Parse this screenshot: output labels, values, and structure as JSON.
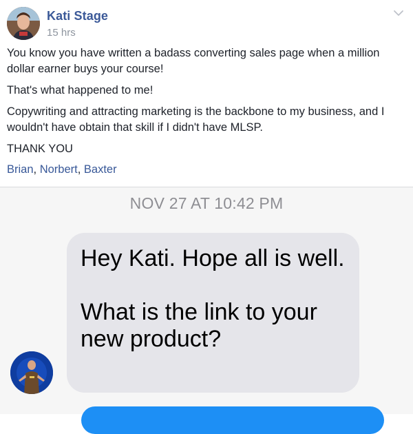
{
  "post": {
    "author": "Kati Stage",
    "timestamp": "15 hrs",
    "paragraphs": [
      "You know you have written a badass converting sales page when a million dollar earner buys your course!",
      "That's what happened to me!",
      "Copywriting and attracting marketing is the backbone to my business, and I wouldn't have obtain that skill if I didn't have MLSP.",
      "THANK YOU"
    ],
    "tags": [
      "Brian",
      "Norbert",
      "Baxter"
    ],
    "tag_separator": ", "
  },
  "chat": {
    "timestamp": "NOV 27 AT 10:42 PM",
    "messages": [
      {
        "line1": "Hey Kati. Hope all is well.",
        "line2": "What is the link to your new product?"
      }
    ]
  },
  "colors": {
    "author_link": "#3b5998",
    "incoming_bubble": "#e5e5ea",
    "outgoing_bubble": "#1d8ff5"
  },
  "icons": {
    "post_menu": "chevron-down-icon",
    "post_avatar": "author-avatar",
    "sender_avatar": "sender-avatar"
  }
}
